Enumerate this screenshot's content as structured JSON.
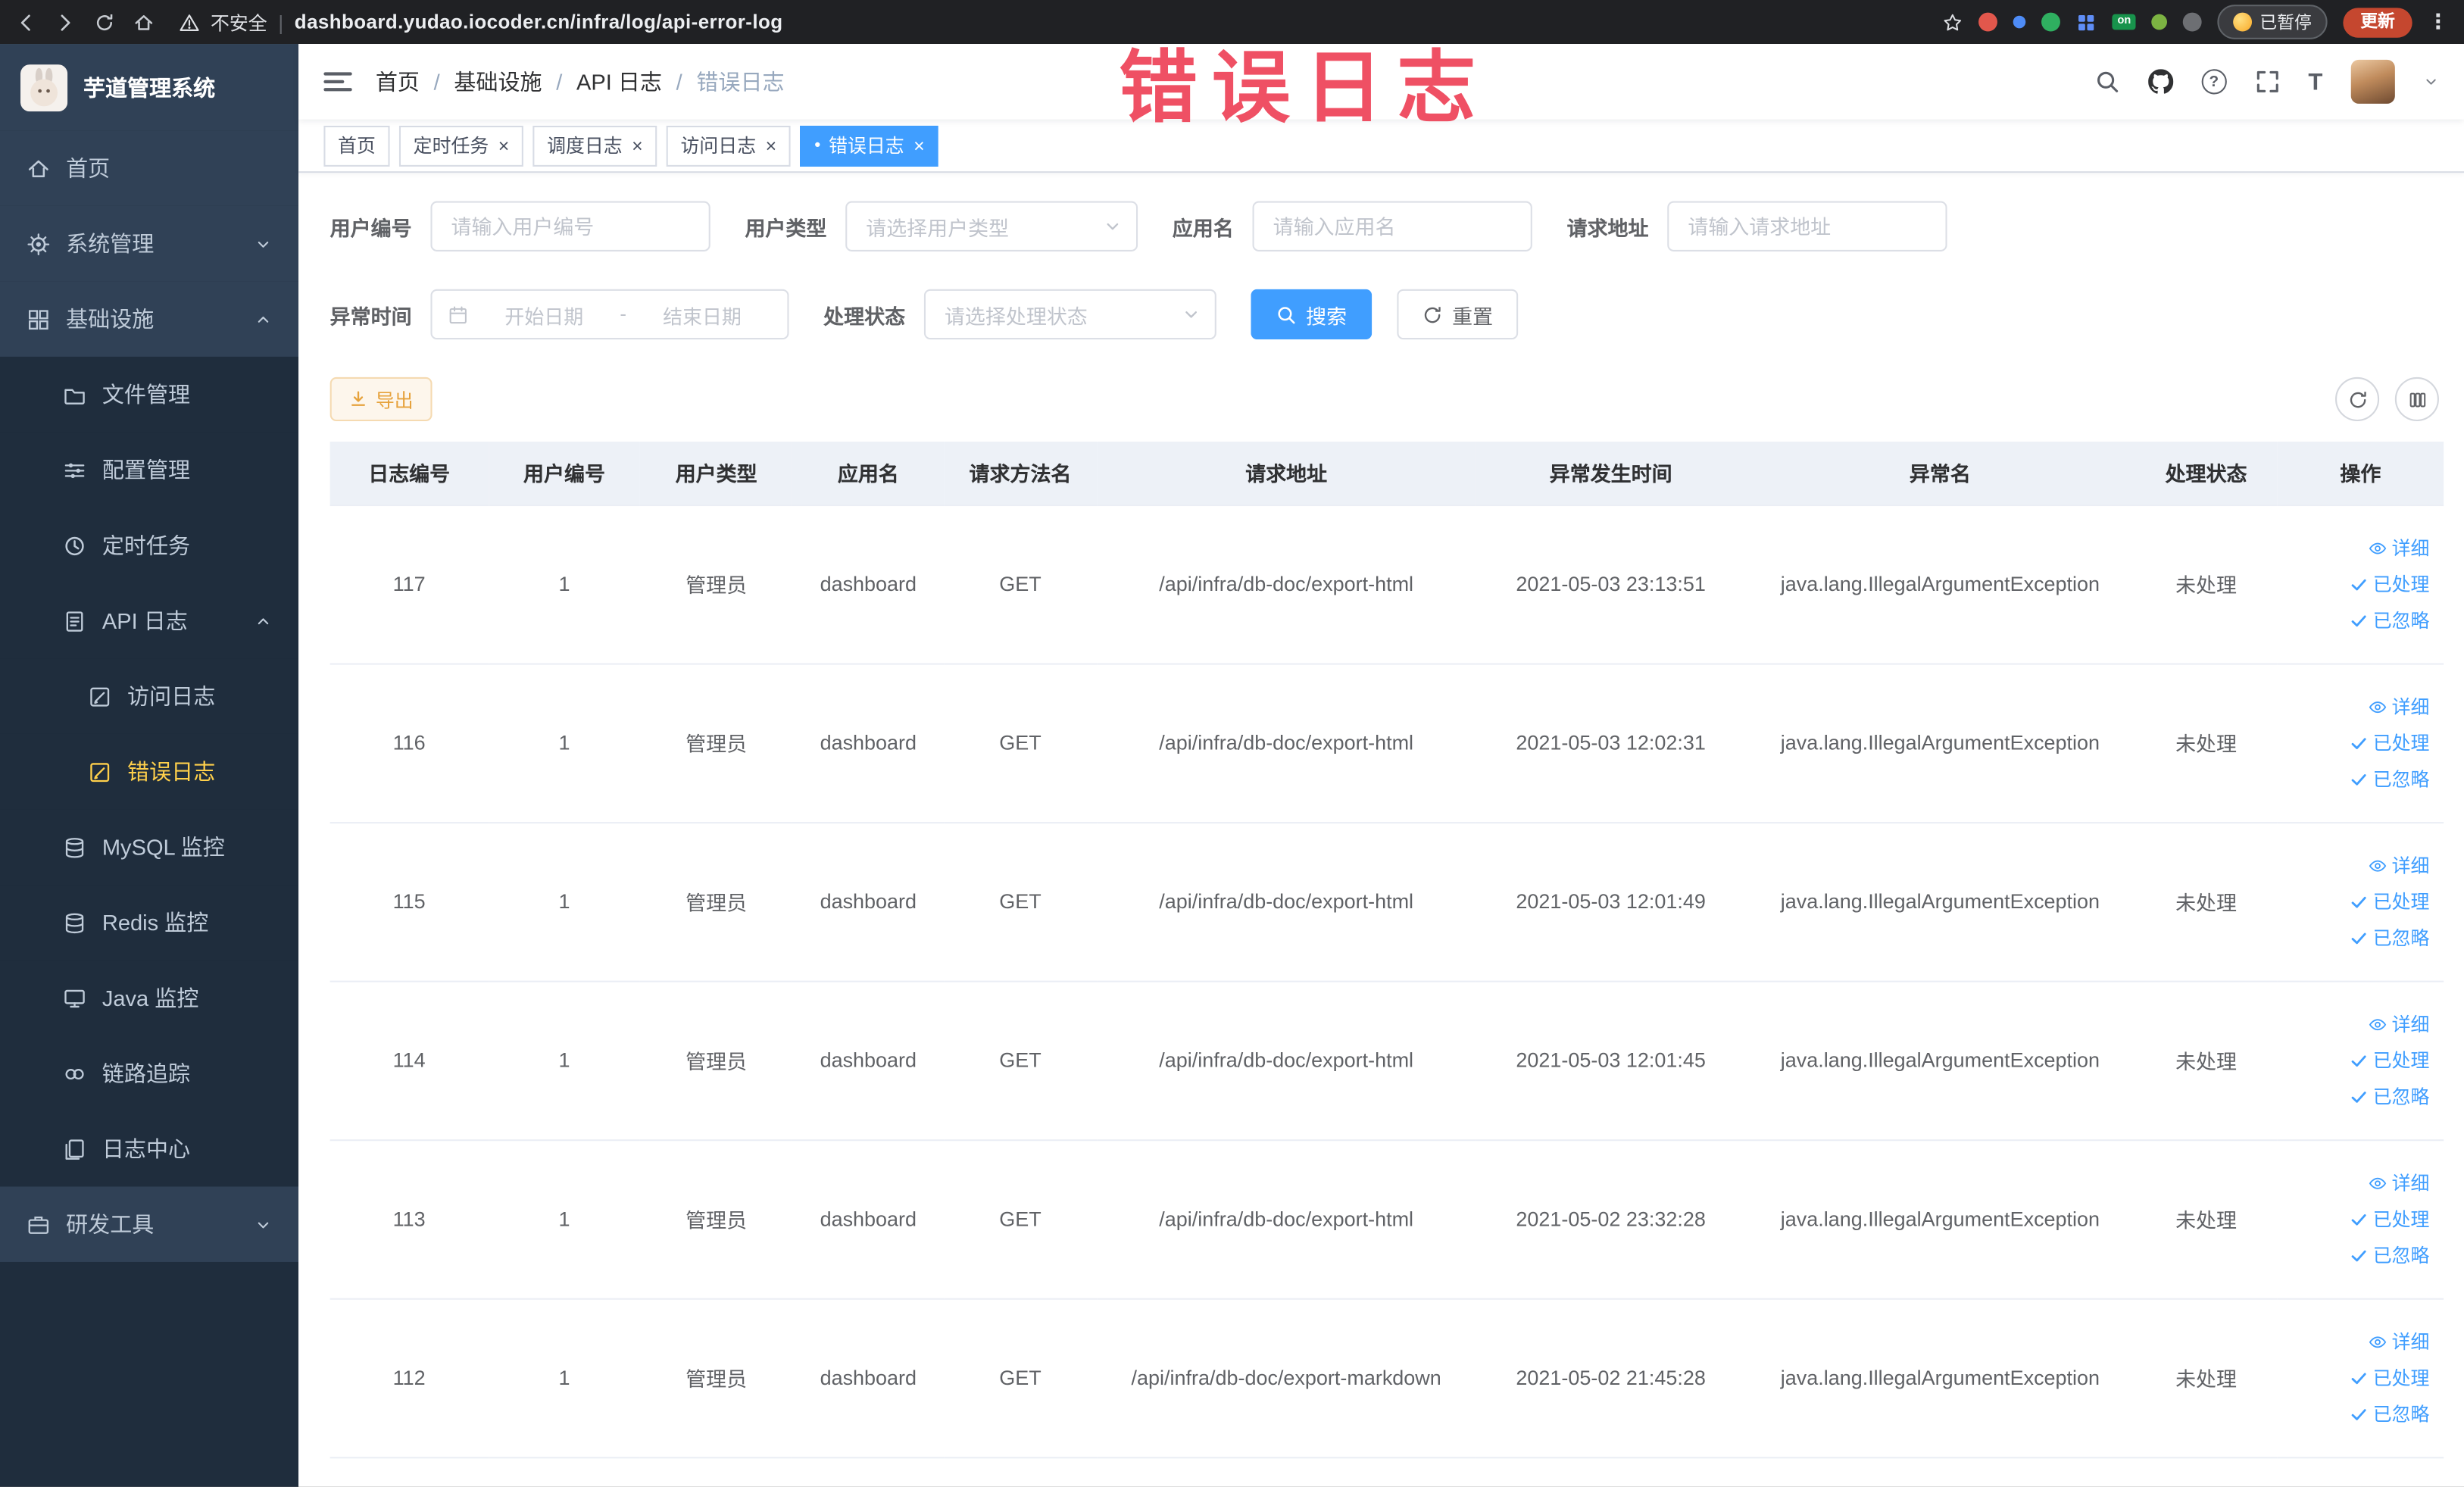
{
  "browser": {
    "security_label": "不安全",
    "url": "dashboard.yudao.iocoder.cn/infra/log/api-error-log",
    "extension_on_badge": "on",
    "paused_chip": "已暂停",
    "update_button": "更新"
  },
  "sidebar": {
    "logo_title": "芋道管理系统",
    "menu": [
      {
        "label": "首页",
        "icon": "home-icon"
      },
      {
        "label": "系统管理",
        "icon": "gear-icon"
      },
      {
        "label": "基础设施",
        "icon": "grid-icon"
      },
      {
        "label": "文件管理",
        "icon": "folder-icon"
      },
      {
        "label": "配置管理",
        "icon": "sliders-icon"
      },
      {
        "label": "定时任务",
        "icon": "clock-icon"
      },
      {
        "label": "API 日志",
        "icon": "document-icon"
      },
      {
        "label": "访问日志",
        "icon": "edit-square-icon"
      },
      {
        "label": "错误日志",
        "icon": "edit-square-icon"
      },
      {
        "label": "MySQL 监控",
        "icon": "database-icon"
      },
      {
        "label": "Redis 监控",
        "icon": "database-icon"
      },
      {
        "label": "Java 监控",
        "icon": "monitor-icon"
      },
      {
        "label": "链路追踪",
        "icon": "link-icon"
      },
      {
        "label": "日志中心",
        "icon": "documents-icon"
      },
      {
        "label": "研发工具",
        "icon": "briefcase-icon"
      }
    ]
  },
  "header": {
    "breadcrumb": [
      {
        "label": "首页"
      },
      {
        "label": "基础设施"
      },
      {
        "label": "API 日志"
      },
      {
        "label": "错误日志"
      }
    ],
    "watermark": "错误日志"
  },
  "tabs": [
    {
      "label": "首页",
      "closable": false,
      "active": false
    },
    {
      "label": "定时任务",
      "closable": true,
      "active": false
    },
    {
      "label": "调度日志",
      "closable": true,
      "active": false
    },
    {
      "label": "访问日志",
      "closable": true,
      "active": false
    },
    {
      "label": "错误日志",
      "closable": true,
      "active": true
    }
  ],
  "filters": {
    "user_id_label": "用户编号",
    "user_id_placeholder": "请输入用户编号",
    "user_type_label": "用户类型",
    "user_type_placeholder": "请选择用户类型",
    "app_name_label": "应用名",
    "app_name_placeholder": "请输入应用名",
    "request_url_label": "请求地址",
    "request_url_placeholder": "请输入请求地址",
    "exception_time_label": "异常时间",
    "date_start_placeholder": "开始日期",
    "date_separator": "-",
    "date_end_placeholder": "结束日期",
    "process_status_label": "处理状态",
    "process_status_placeholder": "请选择处理状态",
    "search_button": "搜索",
    "reset_button": "重置"
  },
  "toolbar": {
    "export_button": "导出"
  },
  "table": {
    "columns": [
      "日志编号",
      "用户编号",
      "用户类型",
      "应用名",
      "请求方法名",
      "请求地址",
      "异常发生时间",
      "异常名",
      "处理状态",
      "操作"
    ],
    "actions": {
      "detail": "详细",
      "processed": "已处理",
      "ignored": "已忽略"
    },
    "rows": [
      {
        "log_id": "117",
        "user_id": "1",
        "user_type": "管理员",
        "app_name": "dashboard",
        "method": "GET",
        "url": "/api/infra/db-doc/export-html",
        "time": "2021-05-03 23:13:51",
        "exception": "java.lang.IllegalArgumentException",
        "status": "未处理"
      },
      {
        "log_id": "116",
        "user_id": "1",
        "user_type": "管理员",
        "app_name": "dashboard",
        "method": "GET",
        "url": "/api/infra/db-doc/export-html",
        "time": "2021-05-03 12:02:31",
        "exception": "java.lang.IllegalArgumentException",
        "status": "未处理"
      },
      {
        "log_id": "115",
        "user_id": "1",
        "user_type": "管理员",
        "app_name": "dashboard",
        "method": "GET",
        "url": "/api/infra/db-doc/export-html",
        "time": "2021-05-03 12:01:49",
        "exception": "java.lang.IllegalArgumentException",
        "status": "未处理"
      },
      {
        "log_id": "114",
        "user_id": "1",
        "user_type": "管理员",
        "app_name": "dashboard",
        "method": "GET",
        "url": "/api/infra/db-doc/export-html",
        "time": "2021-05-03 12:01:45",
        "exception": "java.lang.IllegalArgumentException",
        "status": "未处理"
      },
      {
        "log_id": "113",
        "user_id": "1",
        "user_type": "管理员",
        "app_name": "dashboard",
        "method": "GET",
        "url": "/api/infra/db-doc/export-html",
        "time": "2021-05-02 23:32:28",
        "exception": "java.lang.IllegalArgumentException",
        "status": "未处理"
      },
      {
        "log_id": "112",
        "user_id": "1",
        "user_type": "管理员",
        "app_name": "dashboard",
        "method": "GET",
        "url": "/api/infra/db-doc/export-markdown",
        "time": "2021-05-02 21:45:28",
        "exception": "java.lang.IllegalArgumentException",
        "status": "未处理"
      }
    ]
  },
  "ui": {
    "breadcrumb_separator": "/",
    "url_divider": "|",
    "close_glyph": "×",
    "active_tab_dot": "●",
    "more_vert_glyph": "⋮",
    "question_glyph": "?",
    "text_size_glyph": "T"
  },
  "colors": {
    "primary": "#409eff",
    "sidebar_bg": "#304156",
    "sidebar_submenu_bg": "#1f2d3d",
    "active_menu_text": "#ffd04b",
    "watermark_red": "#ee4257",
    "warning_orange": "#e6a23c",
    "table_header_bg": "#edf1f7"
  }
}
